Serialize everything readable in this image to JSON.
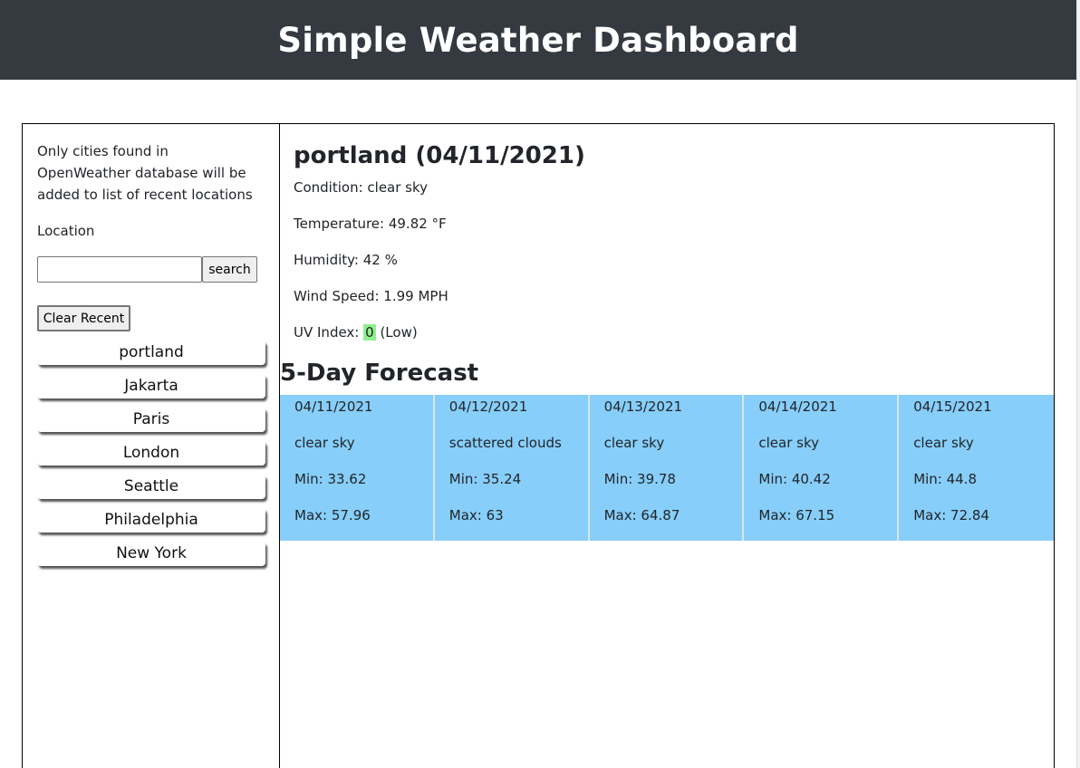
{
  "header": {
    "title": "Simple Weather Dashboard"
  },
  "sidebar": {
    "note": "Only cities found in OpenWeather database will be added to list of recent locations",
    "location_label": "Location",
    "search_value": "",
    "search_button": "search",
    "clear_button": "Clear Recent",
    "recent": [
      "portland",
      "Jakarta",
      "Paris",
      "London",
      "Seattle",
      "Philadelphia",
      "New York"
    ]
  },
  "current": {
    "title": "portland (04/11/2021)",
    "condition": "Condition: clear sky",
    "temperature": "Temperature: 49.82 °F",
    "humidity": "Humidity: 42 %",
    "wind": "Wind Speed: 1.99 MPH",
    "uv_label": "UV Index: ",
    "uv_value": "0",
    "uv_rating": "(Low)"
  },
  "forecast": {
    "title": "5-Day Forecast",
    "days": [
      {
        "date": "04/11/2021",
        "condition": "clear sky",
        "min": "Min: 33.62",
        "max": "Max: 57.96"
      },
      {
        "date": "04/12/2021",
        "condition": "scattered clouds",
        "min": "Min: 35.24",
        "max": "Max: 63"
      },
      {
        "date": "04/13/2021",
        "condition": "clear sky",
        "min": "Min: 39.78",
        "max": "Max: 64.87"
      },
      {
        "date": "04/14/2021",
        "condition": "clear sky",
        "min": "Min: 40.42",
        "max": "Max: 67.15"
      },
      {
        "date": "04/15/2021",
        "condition": "clear sky",
        "min": "Min: 44.8",
        "max": "Max: 72.84"
      }
    ]
  },
  "colors": {
    "header_bg": "#343a40",
    "forecast_bg": "#87cefa",
    "uv_low": "#90ee90"
  }
}
